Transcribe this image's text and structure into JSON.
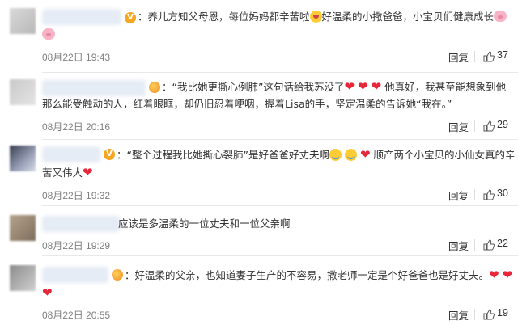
{
  "comments": [
    {
      "text_before": "养儿方知父母恩，每位妈妈都辛苦啦",
      "text_after": "好温柔的小撒爸爸，小宝贝们健康成长",
      "time": "08月22日 19:43",
      "reply_label": "回复",
      "likes": "37"
    },
    {
      "text_line1_before": "“我比她更撕心例肺”这句话给我苏没了",
      "text_line1_after": "他真好，我甚至能想象到他",
      "text_line2": "那么能受触动的人，红着眼眶，却仍旧忍着哽咽，握着Lisa的手，坚定温柔的告诉她“我在。”",
      "time": "08月22日 20:16",
      "reply_label": "回复",
      "likes": "29"
    },
    {
      "text_line1_before": "“整个过程我比她撕心裂肺”是好爸爸好丈夫啊",
      "text_line1_after": "顺产两个小宝贝的小仙女真的辛",
      "text_line2": "苦又伟大",
      "time": "08月22日 19:32",
      "reply_label": "回复",
      "likes": "30"
    },
    {
      "text": "应该是多温柔的一位丈夫和一位父亲啊",
      "time": "08月22日 19:29",
      "reply_label": "回复",
      "likes": "22"
    },
    {
      "text": "好温柔的父亲，也知道妻子生产的不容易，撒老师一定是个好爸爸也是好丈夫。",
      "time": "08月22日 20:55",
      "reply_label": "回复",
      "likes": "19"
    }
  ],
  "vip_badge": "V",
  "colors": {
    "text": "#333333",
    "time": "#808080",
    "heart": "#e8263a",
    "vip": "#f5a623",
    "divider": "#e8e8e8"
  },
  "icons": [
    "heart-emoji",
    "shy-face-emoji",
    "crying-face-emoji",
    "pig-emoji",
    "vip-badge-icon",
    "thumbs-up-icon"
  ]
}
